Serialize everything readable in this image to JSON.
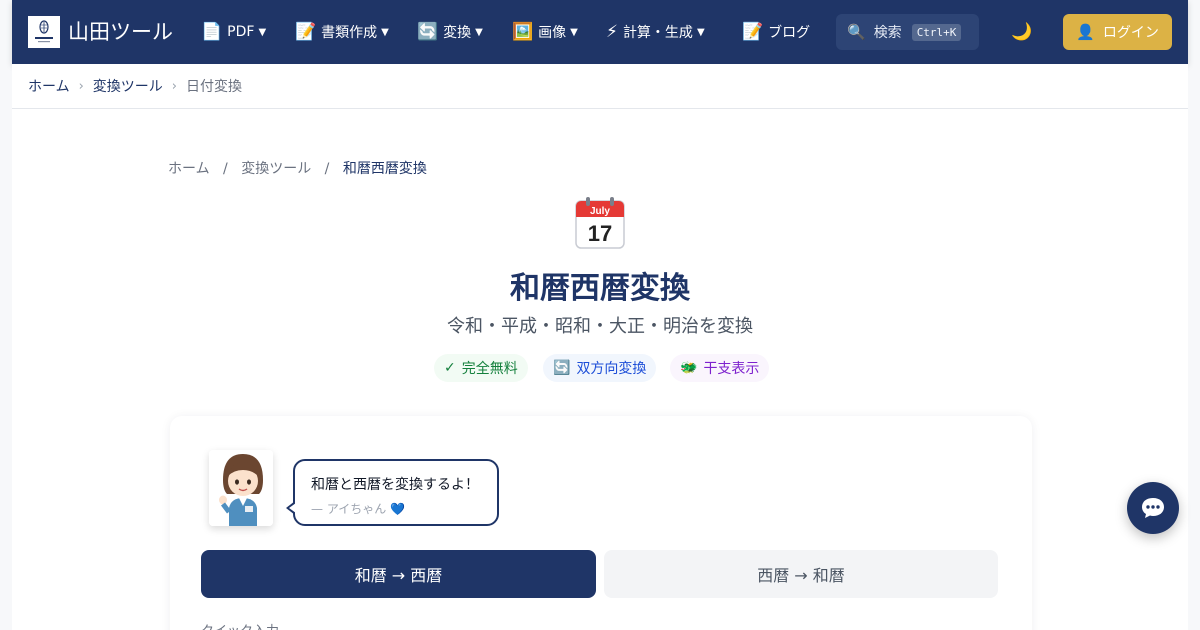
{
  "header": {
    "brand": "山田ツール",
    "nav": [
      {
        "icon": "📄",
        "label": "PDF",
        "dropdown": true
      },
      {
        "icon": "📝",
        "label": "書類作成",
        "dropdown": true
      },
      {
        "icon": "🔄",
        "label": "変換",
        "dropdown": true
      },
      {
        "icon": "🖼️",
        "label": "画像",
        "dropdown": true
      },
      {
        "icon": "⚡",
        "label": "計算・生成",
        "dropdown": true
      },
      {
        "icon": "📝",
        "label": "ブログ",
        "dropdown": false
      }
    ],
    "search": {
      "icon": "🔍",
      "label": "検索",
      "shortcut": "Ctrl+K"
    },
    "theme_icon": "🌙",
    "login": {
      "icon": "👤",
      "label": "ログイン"
    }
  },
  "breadcrumb_top": [
    "ホーム",
    "変換ツール",
    "日付変換"
  ],
  "breadcrumb_page": [
    "ホーム",
    "変換ツール",
    "和暦西暦変換"
  ],
  "calendar_icon": {
    "month": "July",
    "day": "17"
  },
  "page": {
    "title": "和暦西暦変換",
    "subtitle": "令和・平成・昭和・大正・明治を変換"
  },
  "badges": [
    {
      "icon": "✓",
      "label": "完全無料"
    },
    {
      "icon": "🔄",
      "label": "双方向変換"
    },
    {
      "icon": "🐲",
      "label": "干支表示"
    }
  ],
  "speech": {
    "text": "和暦と西暦を変換するよ！",
    "signature": "— アイちゃん 💙"
  },
  "modes": [
    "和暦 → 西暦",
    "西暦 → 和暦"
  ],
  "quick_input_label": "クイック入力",
  "icons": {
    "logo": "yamada-logo",
    "chat": "chat-bubble-icon"
  },
  "colors": {
    "navy": "#1f3567",
    "gold": "#dcb245",
    "free_green": "#15803d",
    "bi_blue": "#1d4ed8",
    "eto_purple": "#7e22ce"
  }
}
